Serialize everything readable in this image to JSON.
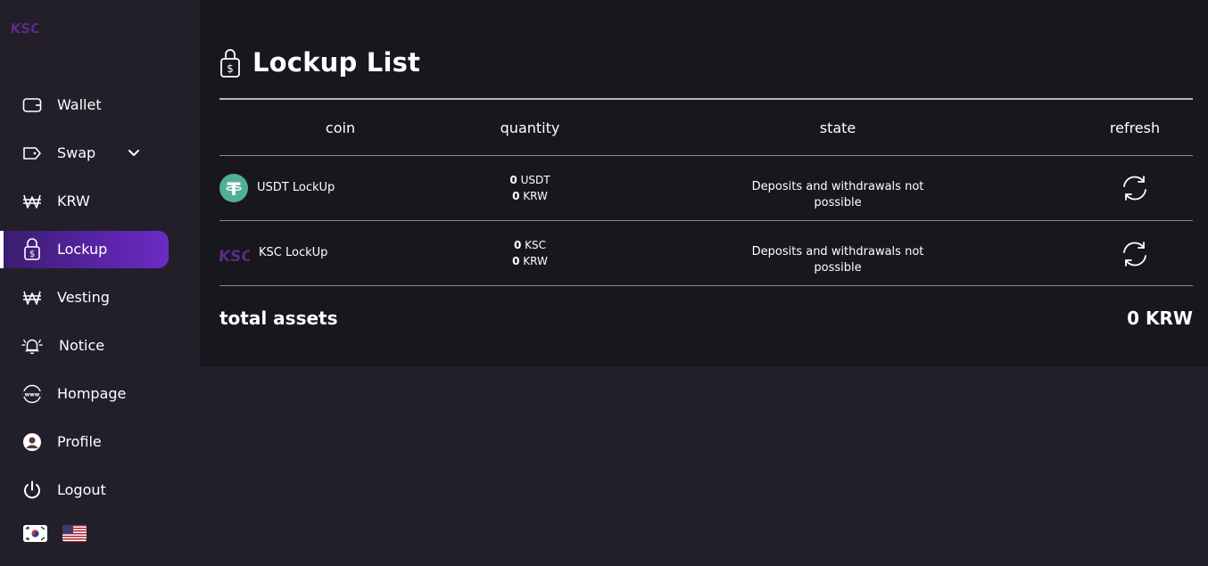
{
  "sidebar": {
    "items": [
      {
        "label": "Wallet",
        "icon": "wallet-icon"
      },
      {
        "label": "Swap",
        "icon": "tag-icon"
      },
      {
        "label": "KRW",
        "icon": "won-icon"
      },
      {
        "label": "Lockup",
        "icon": "lock-dollar-icon",
        "active": true
      },
      {
        "label": "Vesting",
        "icon": "won-icon"
      },
      {
        "label": "Notice",
        "icon": "alarm-bell-icon"
      },
      {
        "label": "Hompage",
        "icon": "www-globe-icon"
      },
      {
        "label": "Profile",
        "icon": "user-avatar-icon"
      },
      {
        "label": "Logout",
        "icon": "power-icon"
      }
    ],
    "languages": [
      "korean-flag-icon",
      "us-flag-icon"
    ]
  },
  "page": {
    "title": "Lockup List"
  },
  "table": {
    "headers": {
      "coin": "coin",
      "quantity": "quantity",
      "state": "state",
      "refresh": "refresh"
    },
    "rows": [
      {
        "coin": "USDT LockUp",
        "qty1_value": "0",
        "qty1_unit": "USDT",
        "qty2_value": "0",
        "qty2_unit": "KRW",
        "state": "Deposits and withdrawals not possible"
      },
      {
        "coin": "KSC LockUp",
        "qty1_value": "0",
        "qty1_unit": "KSC",
        "qty2_value": "0",
        "qty2_unit": "KRW",
        "state": "Deposits and withdrawals not possible"
      }
    ]
  },
  "total": {
    "label": "total assets",
    "value": "0 KRW"
  },
  "colors": {
    "background": "#221f2b",
    "panel": "#18171d",
    "accent": "#6b2bc4",
    "tether": "#50af95",
    "ksc_purple": "#5b2a86"
  }
}
